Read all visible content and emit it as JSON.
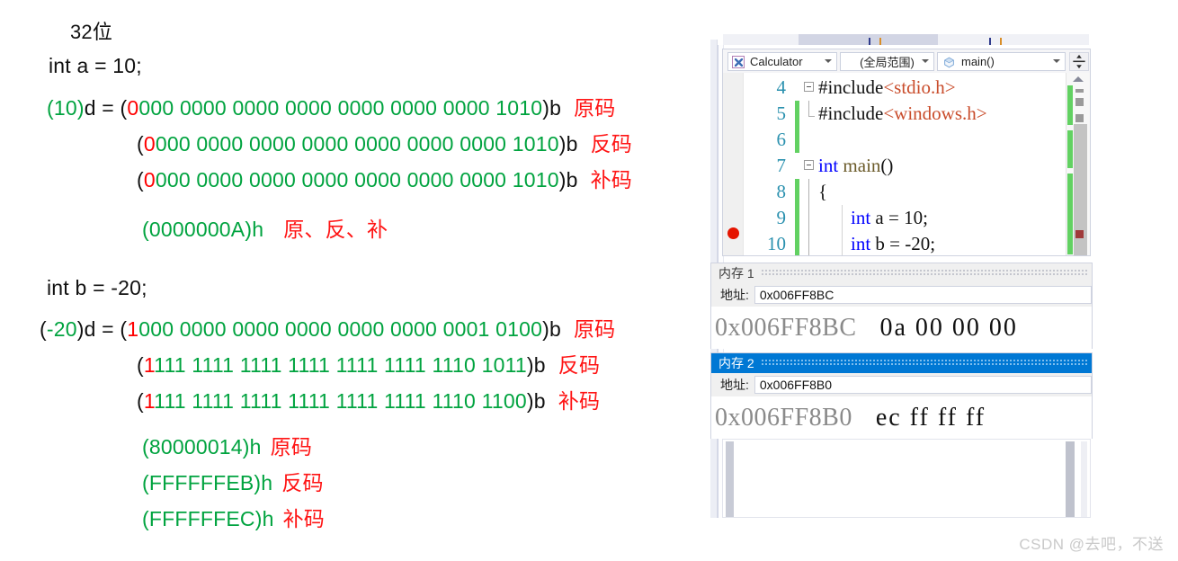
{
  "notes": {
    "heading": "32位",
    "section_a": {
      "decl": "int a = 10;",
      "lines": [
        {
          "prefix_dec": "(10)",
          "prefix_tail": "d = (",
          "sign_bit": "0",
          "rest_bits": "000 0000 0000 0000 0000 0000 0000 1010",
          "suffix": ")b",
          "label": "原码"
        },
        {
          "prefix_dec": "",
          "prefix_tail": "(",
          "sign_bit": "0",
          "rest_bits": "000 0000 0000 0000 0000 0000 0000 1010",
          "suffix": ")b",
          "label": "反码"
        },
        {
          "prefix_dec": "",
          "prefix_tail": "(",
          "sign_bit": "0",
          "rest_bits": "000 0000 0000 0000 0000 0000 0000 1010",
          "suffix": ")b",
          "label": "补码"
        }
      ],
      "hex_line": {
        "hex": "(0000000A)",
        "suffix": "h",
        "label": "原、反、补"
      }
    },
    "section_b": {
      "decl": "int b = -20;",
      "lines": [
        {
          "prefix_dec": "(-20)",
          "prefix_tail": "d = (",
          "sign_bit": "1",
          "rest_bits": "000 0000 0000 0000 0000 0000 0001 0100",
          "suffix": ")b",
          "label": "原码"
        },
        {
          "prefix_dec": "",
          "prefix_tail": "(",
          "sign_bit": "1",
          "rest_bits": "111 1111 1111 1111 1111 1111 1110 1011",
          "suffix": ")b",
          "label": "反码"
        },
        {
          "prefix_dec": "",
          "prefix_tail": "(",
          "sign_bit": "1",
          "rest_bits": "111 1111 1111 1111 1111 1111 1110 1100",
          "suffix": ")b",
          "label": "补码"
        }
      ],
      "hex_lines": [
        {
          "hex": "(80000014)",
          "suffix": "h",
          "label": "原码"
        },
        {
          "hex": "(FFFFFFEB)",
          "suffix": "h",
          "label": "反码"
        },
        {
          "hex": "(FFFFFFEC)",
          "suffix": "h",
          "label": "补码"
        }
      ]
    }
  },
  "vs": {
    "navbar": {
      "class_combo": "Calculator",
      "scope_combo": "(全局范围)",
      "function_combo": "main()"
    },
    "editor": {
      "rows": [
        {
          "num": "4",
          "code": "#include<stdio.h>"
        },
        {
          "num": "5",
          "code": "#include<windows.h>"
        },
        {
          "num": "6",
          "code": ""
        },
        {
          "num": "7",
          "code": "int main()"
        },
        {
          "num": "8",
          "code": "{"
        },
        {
          "num": "9",
          "code": "int a = 10;"
        },
        {
          "num": "10",
          "code": "int b = -20;"
        }
      ]
    },
    "memory1": {
      "title": "内存 1",
      "address_label": "地址:",
      "address_value": "0x006FF8BC",
      "row_address": "0x006FF8BC",
      "row_bytes": "0a 00 00 00"
    },
    "memory2": {
      "title": "内存 2",
      "address_label": "地址:",
      "address_value": "0x006FF8B0",
      "row_address": "0x006FF8B0",
      "row_bytes": "ec ff ff ff"
    }
  },
  "watermark": "CSDN @去吧，不送",
  "colors": {
    "green": "#00a33f",
    "red": "#ff1414",
    "sign_red": "#ff0000",
    "vs_accent": "#0078d4",
    "linenum": "#2b91af",
    "changebar": "#62d162",
    "breakpoint": "#e51400"
  }
}
